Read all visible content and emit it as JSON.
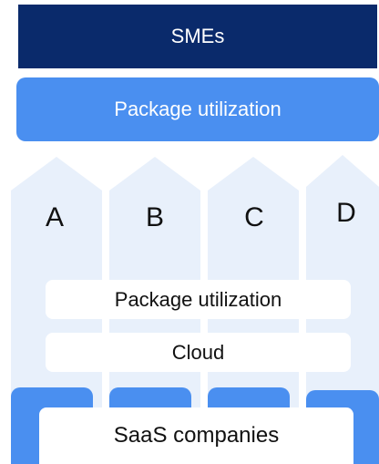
{
  "diagram": {
    "top_banner": {
      "label": "SMEs"
    },
    "utilization_banner": {
      "label": "Package utilization"
    },
    "columns": [
      {
        "label": "A"
      },
      {
        "label": "B"
      },
      {
        "label": "C"
      },
      {
        "label": "D"
      }
    ],
    "middle_layers": [
      {
        "label": "Package utilization"
      },
      {
        "label": "Cloud"
      }
    ],
    "base": {
      "label": "SaaS companies"
    },
    "colors": {
      "navy": "#0a2a6b",
      "blue": "#4a8ff0",
      "arrow_fill": "#e8f0fb"
    }
  }
}
